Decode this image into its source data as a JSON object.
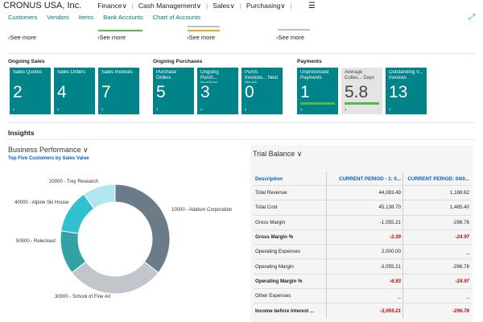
{
  "app": {
    "company": "CRONUS USA, Inc."
  },
  "top_menu": [
    {
      "label": "Finance"
    },
    {
      "label": "Cash Management"
    },
    {
      "label": "Sales"
    },
    {
      "label": "Purchasing"
    }
  ],
  "nav_links": [
    "Customers",
    "Vendors",
    "Items",
    "Bank Accounts",
    "Chart of Accounts"
  ],
  "see_more_label": "See more",
  "groups": {
    "sales": {
      "title": "Ongoing Sales",
      "tiles": [
        {
          "label": "Sales Quotes",
          "value": "2"
        },
        {
          "label": "Sales Orders",
          "value": "4"
        },
        {
          "label": "Sales Invoices",
          "value": "7"
        }
      ]
    },
    "purchases": {
      "title": "Ongoing Purchases",
      "tiles": [
        {
          "label": "Purchase Orders",
          "value": "5"
        },
        {
          "label": "Ongoing Purch... Invoices",
          "value": "3"
        },
        {
          "label": "Purch. Invoices... Next Week",
          "value": "0"
        }
      ]
    },
    "payments": {
      "title": "Payments",
      "tiles": [
        {
          "label": "Unprocessed Payments",
          "value": "1"
        },
        {
          "label": "Average Collec... Days",
          "value": "5.8"
        },
        {
          "label": "Outstanding V... Invoices",
          "value": "13"
        }
      ]
    }
  },
  "insights": {
    "title": "Insights"
  },
  "business_performance": {
    "title": "Business Performance",
    "subtitle": "Top Five Customers by Sales Value"
  },
  "chart_data": {
    "type": "pie",
    "categories": [
      "10000 - Adatum Corporation",
      "30000 - School of Fine Art",
      "50000 - Relecloud",
      "40000 - Alpine Ski House",
      "20000 - Trey Research"
    ],
    "values": [
      33,
      27,
      12,
      12,
      9
    ],
    "colors": [
      "#6b7b88",
      "#c1c6cc",
      "#32a2a5",
      "#30c0cf",
      "#b2e6ee"
    ]
  },
  "trial_balance": {
    "title": "Trial Balance",
    "columns": [
      "Description",
      "CURRENT PERIOD - 1: 0...",
      "CURRENT PERIOD: 04/0..."
    ],
    "rows": [
      {
        "desc": "Total Revenue",
        "p1": "44,083.49",
        "p2": "1,188.62",
        "bold": false,
        "neg1": false,
        "neg2": false
      },
      {
        "desc": "Total Cost",
        "p1": "45,138.70",
        "p2": "1,485.40",
        "bold": false,
        "neg1": false,
        "neg2": false
      },
      {
        "desc": "Gross Margin",
        "p1": "-1,055.21",
        "p2": "-296.78",
        "bold": false,
        "neg1": false,
        "neg2": false
      },
      {
        "desc": "Gross Margin %",
        "p1": "-2.39",
        "p2": "-24.97",
        "bold": true,
        "neg1": true,
        "neg2": true
      },
      {
        "desc": "Operating Expenses",
        "p1": "2,000.00",
        "p2": "_",
        "bold": false,
        "neg1": false,
        "neg2": false
      },
      {
        "desc": "Operating Margin",
        "p1": "-3,055.21",
        "p2": "-296.78",
        "bold": false,
        "neg1": false,
        "neg2": false
      },
      {
        "desc": "Operating Margin %",
        "p1": "-6.93",
        "p2": "-24.97",
        "bold": true,
        "neg1": true,
        "neg2": true
      },
      {
        "desc": "Other Expenses",
        "p1": "_",
        "p2": "_",
        "bold": false,
        "neg1": false,
        "neg2": false
      },
      {
        "desc": "Income before Interest ...",
        "p1": "-3,055.21",
        "p2": "-296.78",
        "bold": true,
        "neg1": true,
        "neg2": true
      }
    ]
  }
}
